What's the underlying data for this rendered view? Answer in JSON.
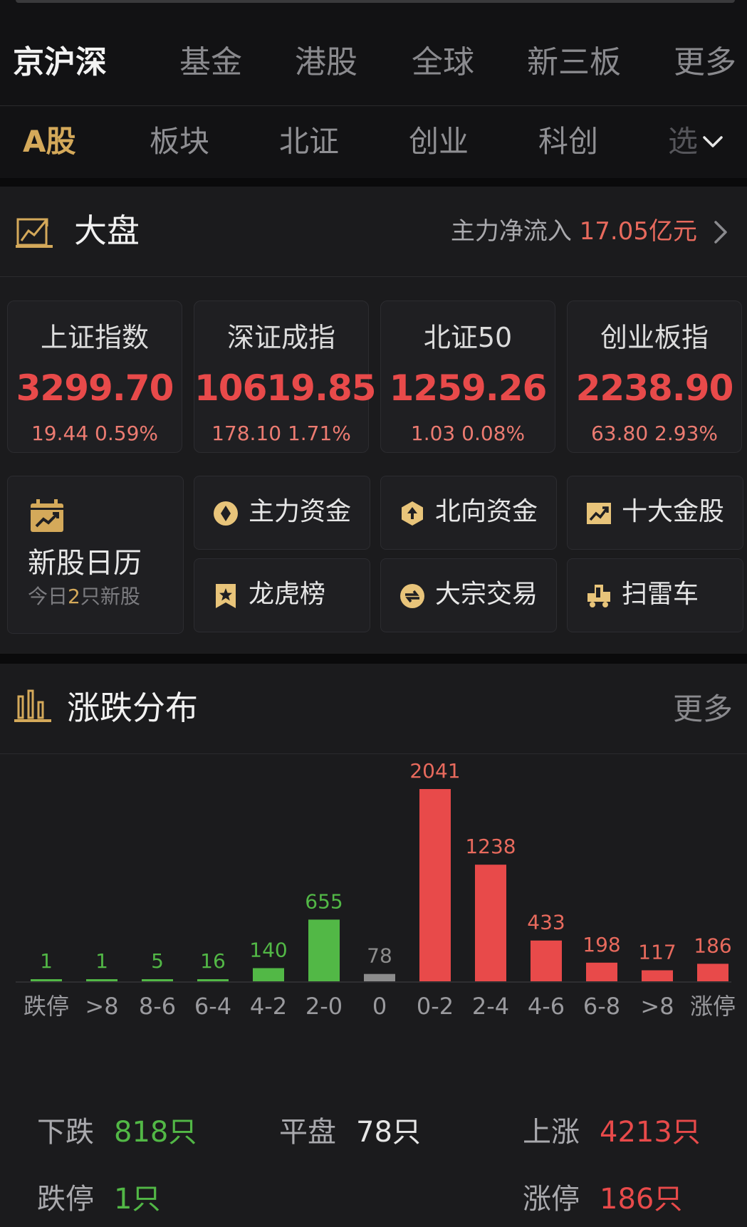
{
  "nav_primary": [
    {
      "label": "京沪深",
      "active": true
    },
    {
      "label": "基金",
      "active": false
    },
    {
      "label": "港股",
      "active": false
    },
    {
      "label": "全球",
      "active": false
    },
    {
      "label": "新三板",
      "active": false
    },
    {
      "label": "更多",
      "active": false
    }
  ],
  "nav_secondary": [
    {
      "label": "A股",
      "active": true
    },
    {
      "label": "板块",
      "active": false
    },
    {
      "label": "北证",
      "active": false
    },
    {
      "label": "创业",
      "active": false
    },
    {
      "label": "科创",
      "active": false
    },
    {
      "label": "选",
      "active": false
    }
  ],
  "market": {
    "title": "大盘",
    "flow_label": "主力净流入",
    "flow_amount": "17.05亿元",
    "indices": [
      {
        "name": "上证指数",
        "value": "3299.70",
        "change": "19.44  0.59%"
      },
      {
        "name": "深证成指",
        "value": "10619.85",
        "change": "178.10  1.71%"
      },
      {
        "name": "北证50",
        "value": "1259.26",
        "change": "1.03  0.08%"
      },
      {
        "name": "创业板指",
        "value": "2238.90",
        "change": "63.80  2.93%"
      }
    ],
    "ipo": {
      "title": "新股日历",
      "sub_prefix": "今日",
      "sub_count": "2",
      "sub_suffix": "只新股"
    },
    "tools": [
      {
        "label": "主力资金",
        "icon": "diamond-circle-icon"
      },
      {
        "label": "北向资金",
        "icon": "hexagon-icon"
      },
      {
        "label": "十大金股",
        "icon": "trend-box-icon"
      },
      {
        "label": "龙虎榜",
        "icon": "bookmark-star-icon"
      },
      {
        "label": "大宗交易",
        "icon": "exchange-circle-icon"
      },
      {
        "label": "扫雷车",
        "icon": "truck-icon"
      }
    ]
  },
  "distribution": {
    "title": "涨跌分布",
    "more_label": "更多",
    "summary": {
      "down_label": "下跌",
      "down_value": "818只",
      "flat_label": "平盘",
      "flat_value": "78只",
      "up_label": "上涨",
      "up_value": "4213只",
      "limit_down_label": "跌停",
      "limit_down_value": "1只",
      "limit_up_label": "涨停",
      "limit_up_value": "186只"
    }
  },
  "colors": {
    "up": "#e84a4a",
    "down": "#52b846",
    "flat": "#8c8c8c",
    "accent": "#d4a95a"
  },
  "chart_data": {
    "type": "bar",
    "categories": [
      "跌停",
      ">8",
      "8-6",
      "6-4",
      "4-2",
      "2-0",
      "0",
      "0-2",
      "2-4",
      "4-6",
      "6-8",
      ">8",
      "涨停"
    ],
    "values": [
      1,
      1,
      5,
      16,
      140,
      655,
      78,
      2041,
      1238,
      433,
      198,
      117,
      186
    ],
    "series_colors": [
      "down",
      "down",
      "down",
      "down",
      "down",
      "down",
      "flat",
      "up",
      "up",
      "up",
      "up",
      "up",
      "up"
    ],
    "ylim": [
      0,
      2041
    ]
  }
}
